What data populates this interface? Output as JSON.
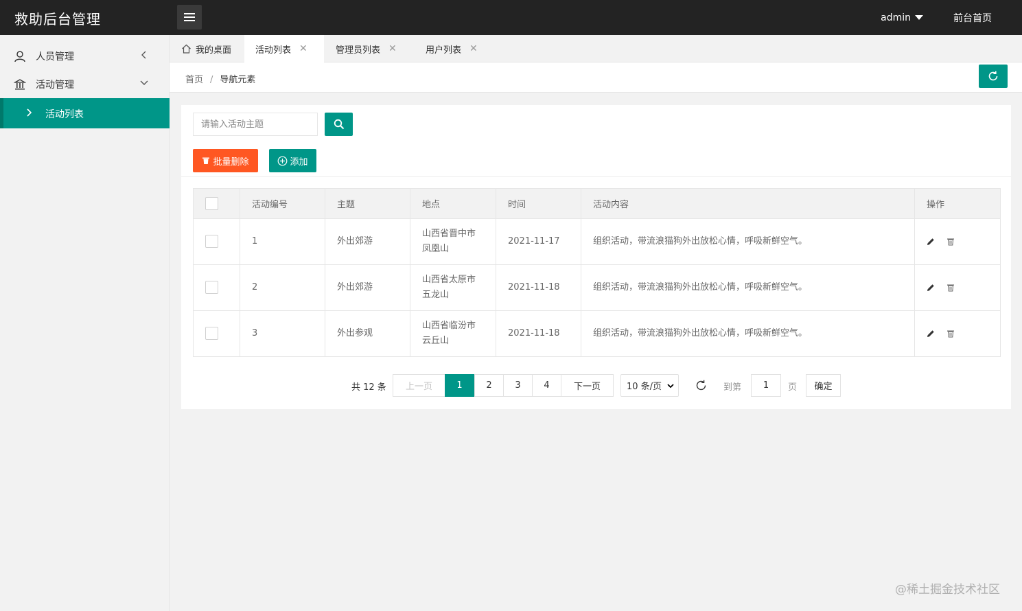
{
  "app": {
    "title": "救助后台管理"
  },
  "topbar": {
    "user": "admin",
    "frontpage": "前台首页"
  },
  "sidebar": {
    "items": [
      {
        "label": "人员管理"
      },
      {
        "label": "活动管理"
      }
    ],
    "subitem": {
      "label": "活动列表"
    }
  },
  "tabs": [
    {
      "label": "我的桌面"
    },
    {
      "label": "活动列表"
    },
    {
      "label": "管理员列表"
    },
    {
      "label": "用户列表"
    }
  ],
  "breadcrumb": {
    "home": "首页",
    "sep": "/",
    "current": "导航元素"
  },
  "toolbar": {
    "search_placeholder": "请输入活动主题",
    "batch_delete": "批量删除",
    "add": "添加"
  },
  "table": {
    "headers": [
      "活动编号",
      "主题",
      "地点",
      "时间",
      "活动内容",
      "操作"
    ],
    "rows": [
      {
        "id": "1",
        "topic": "外出郊游",
        "place_line1": "山西省晋中市",
        "place_line2": "凤凰山",
        "time": "2021-11-17",
        "content": "组织活动，带流浪猫狗外出放松心情，呼吸新鲜空气。"
      },
      {
        "id": "2",
        "topic": "外出郊游",
        "place_line1": "山西省太原市",
        "place_line2": "五龙山",
        "time": "2021-11-18",
        "content": "组织活动，带流浪猫狗外出放松心情，呼吸新鲜空气。"
      },
      {
        "id": "3",
        "topic": "外出参观",
        "place_line1": "山西省临汾市",
        "place_line2": "云丘山",
        "time": "2021-11-18",
        "content": "组织活动，带流浪猫狗外出放松心情，呼吸新鲜空气。"
      }
    ]
  },
  "pager": {
    "total": "共 12 条",
    "prev": "上一页",
    "pages": [
      "1",
      "2",
      "3",
      "4"
    ],
    "next": "下一页",
    "per_page": "10 条/页",
    "goto": "到第",
    "goto_value": "1",
    "page_unit": "页",
    "confirm": "确定"
  },
  "watermark": "@稀土掘金技术社区",
  "colors": {
    "accent": "#009688",
    "danger": "#ff5722",
    "topbar": "#232323"
  }
}
